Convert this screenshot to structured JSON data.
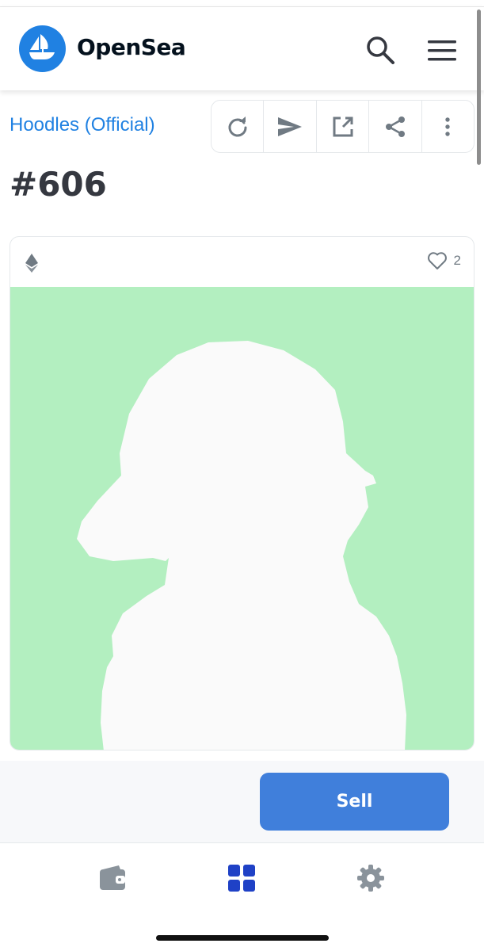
{
  "header": {
    "brand": "OpenSea",
    "icons": [
      "opensea-logo-icon",
      "search-icon",
      "menu-icon"
    ]
  },
  "asset": {
    "collection": "Hoodles (Official)",
    "title": "#606",
    "toolbar_icons": [
      "refresh-icon",
      "send-icon",
      "external-link-icon",
      "share-icon",
      "more-icon"
    ],
    "chain_icon": "ethereum-icon",
    "favorites": "2",
    "image_background": "#b3efc0"
  },
  "actions": {
    "sell_label": "Sell"
  },
  "bottom_nav": {
    "items": [
      "wallet-icon",
      "grid-icon",
      "settings-icon"
    ],
    "active": "grid-icon"
  },
  "colors": {
    "accent": "#2081e2",
    "button": "#407fdb",
    "text": "#353840"
  }
}
